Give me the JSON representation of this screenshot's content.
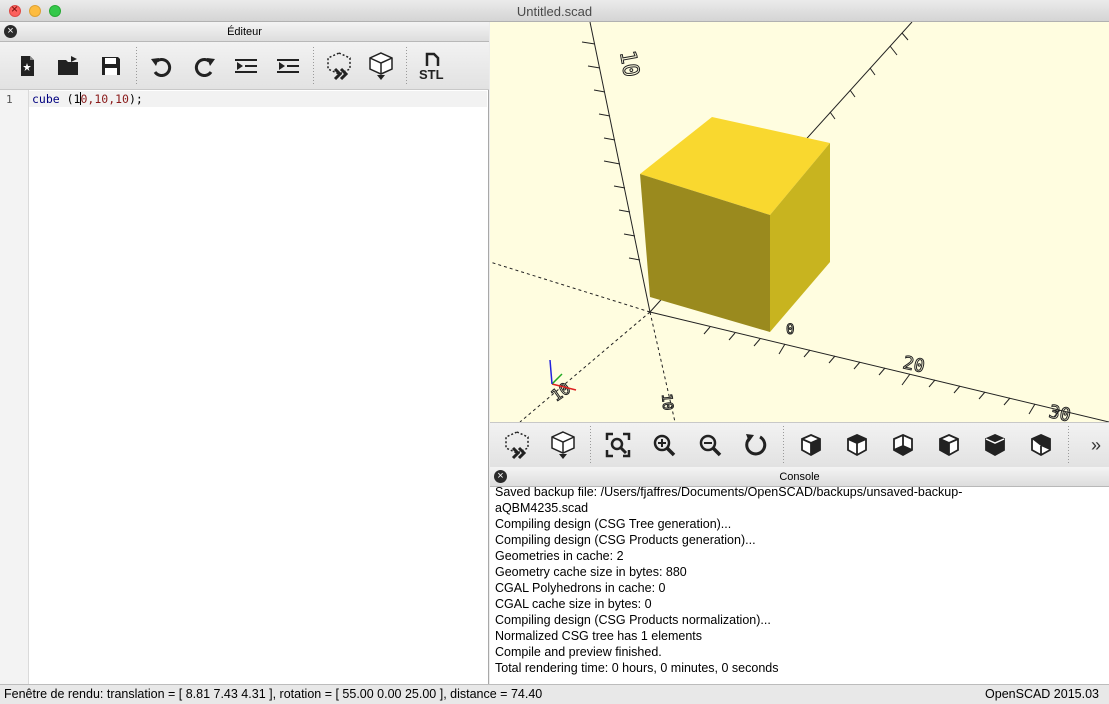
{
  "window": {
    "title": "Untitled.scad"
  },
  "editor": {
    "header": "Éditeur",
    "line_number": "1",
    "code": {
      "kw": "cube",
      "open": " (1",
      "after_caret": "0",
      "a": ",10,10",
      "close": ");"
    }
  },
  "console": {
    "header": "Console",
    "lines": [
      "Saved backup file: /Users/fjaffres/Documents/OpenSCAD/backups/unsaved-backup-",
      "aQBM4235.scad",
      "Compiling design (CSG Tree generation)...",
      "Compiling design (CSG Products generation)...",
      "Geometries in cache: 2",
      "Geometry cache size in bytes: 880",
      "CGAL Polyhedrons in cache: 0",
      "CGAL cache size in bytes: 0",
      "Compiling design (CSG Products normalization)...",
      "Normalized CSG tree has 1 elements",
      "Compile and preview finished.",
      "Total rendering time: 0 hours, 0 minutes, 0 seconds"
    ]
  },
  "viewport": {
    "axis_labels": {
      "z10": "10",
      "x0": "0",
      "x20": "20",
      "x30": "30",
      "y10": "10",
      "zl": "10"
    },
    "colors": {
      "background": "#fffde0",
      "cube_top": "#f9d82f",
      "cube_left": "#9a8a1e",
      "cube_right": "#c8b41f"
    }
  },
  "editor_toolbar": {
    "icons": [
      "new-file-icon",
      "open-file-icon",
      "save-icon",
      "undo-icon",
      "redo-icon",
      "unindent-icon",
      "indent-icon",
      "preview-icon",
      "render-icon",
      "export-stl-icon"
    ],
    "stl_label": "STL"
  },
  "view_toolbar": {
    "icons": [
      "preview-icon",
      "render-icon",
      "zoom-all-icon",
      "zoom-in-icon",
      "zoom-out-icon",
      "reset-view-icon",
      "view-right-icon",
      "view-top-icon",
      "view-bottom-icon",
      "view-left-icon",
      "view-front-icon",
      "view-back-icon"
    ],
    "more": "»"
  },
  "status": {
    "left": "Fenêtre de rendu: translation = [ 8.81 7.43 4.31 ], rotation = [ 55.00 0.00 25.00 ], distance = 74.40",
    "right": "OpenSCAD 2015.03"
  }
}
